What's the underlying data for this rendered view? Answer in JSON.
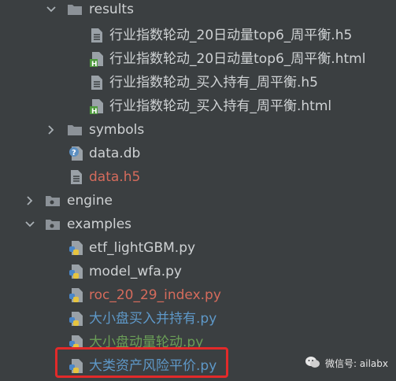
{
  "tree": {
    "rows": [
      {
        "label": "results",
        "icon": "folder-icon",
        "color": "normal"
      },
      {
        "label": "行业指数轮动_20日动量top6_周平衡.h5",
        "icon": "file-icon",
        "color": "normal"
      },
      {
        "label": "行业指数轮动_20日动量top6_周平衡.html",
        "icon": "html-file-icon",
        "color": "normal"
      },
      {
        "label": "行业指数轮动_买入持有_周平衡.h5",
        "icon": "file-icon",
        "color": "normal"
      },
      {
        "label": "行业指数轮动_买入持有_周平衡.html",
        "icon": "html-file-icon",
        "color": "normal"
      },
      {
        "label": "symbols",
        "icon": "folder-icon",
        "color": "normal"
      },
      {
        "label": "data.db",
        "icon": "db-file-icon",
        "color": "normal"
      },
      {
        "label": "data.h5",
        "icon": "file-icon",
        "color": "red"
      },
      {
        "label": "engine",
        "icon": "package-folder-icon",
        "color": "normal"
      },
      {
        "label": "examples",
        "icon": "package-folder-icon",
        "color": "normal"
      },
      {
        "label": "etf_lightGBM.py",
        "icon": "python-file-icon",
        "color": "normal"
      },
      {
        "label": "model_wfa.py",
        "icon": "python-file-icon",
        "color": "normal"
      },
      {
        "label": "roc_20_29_index.py",
        "icon": "python-file-icon",
        "color": "red"
      },
      {
        "label": "大小盘买入并持有.py",
        "icon": "python-file-icon",
        "color": "blue"
      },
      {
        "label": "大小盘动量轮动.py",
        "icon": "python-file-icon",
        "color": "green"
      },
      {
        "label": "大类资产风险平价.py",
        "icon": "python-file-icon",
        "color": "blue"
      }
    ]
  },
  "watermark": {
    "text": "微信号: ailabx"
  },
  "colors": {
    "background": "#3b3f41",
    "text_normal": "#cfd2d4",
    "text_modified": "#5e98c8",
    "text_untracked": "#d56b5c",
    "text_added": "#6a9e57",
    "highlight_box": "#e22a2a"
  }
}
